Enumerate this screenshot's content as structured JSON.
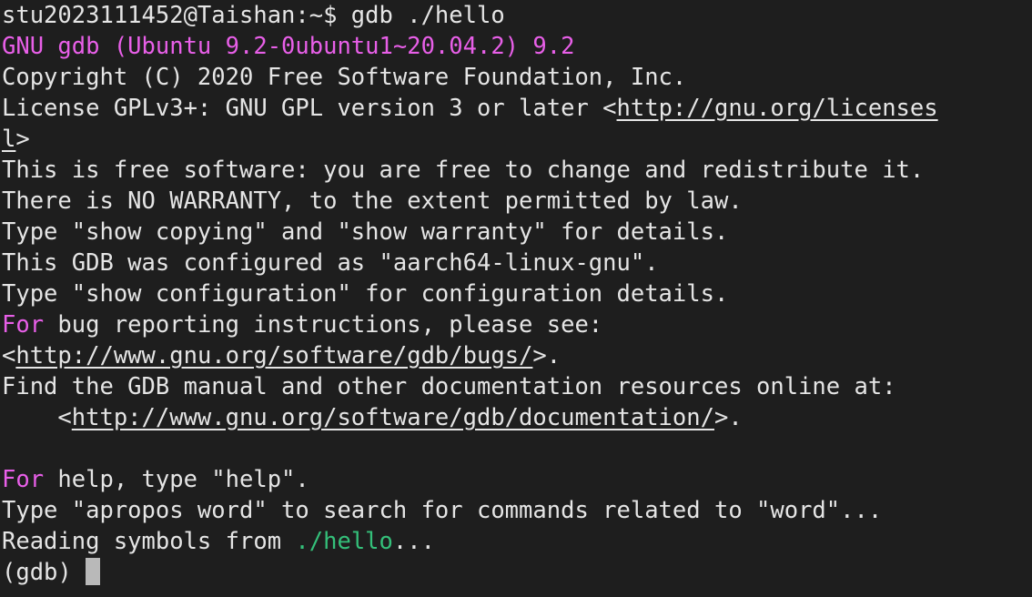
{
  "terminal": {
    "prompt_line": "stu2023111452@Taishan:~$ gdb ./hello",
    "gdb_version": "GNU gdb (Ubuntu 9.2-0ubuntu1~20.04.2) 9.2",
    "copyright": "Copyright (C) 2020 Free Software Foundation, Inc.",
    "license_prefix": "License GPLv3+: GNU GPL version 3 or later <",
    "license_link_part1": "http://gnu.org/licenses",
    "license_link_part2": "l",
    "license_suffix": ">",
    "free_software": "This is free software: you are free to change and redistribute it.",
    "no_warranty": "There is NO WARRANTY, to the extent permitted by law.",
    "show_copying": "Type \"show copying\" and \"show warranty\" for details.",
    "configured_as": "This GDB was configured as \"aarch64-linux-gnu\".",
    "show_config": "Type \"show configuration\" for configuration details.",
    "for_keyword": "For",
    "bug_reporting_rest": " bug reporting instructions, please see:",
    "bugs_prefix": "<",
    "bugs_link": "http://www.gnu.org/software/gdb/bugs/",
    "bugs_suffix": ">.",
    "find_manual": "Find the GDB manual and other documentation resources online at:",
    "doc_prefix": "    <",
    "doc_link": "http://www.gnu.org/software/gdb/documentation/",
    "doc_suffix": ">.",
    "help_rest": " help, type \"help\".",
    "apropos": "Type \"apropos word\" to search for commands related to \"word\"...",
    "reading_prefix": "Reading symbols from ",
    "reading_file": "./hello",
    "reading_suffix": "...",
    "gdb_prompt": "(gdb) "
  },
  "colors": {
    "background": "#1e1e1e",
    "foreground": "#e5e5e5",
    "magenta": "#e85fe8",
    "green": "#34c07a",
    "cursor": "#b9b9b9"
  }
}
